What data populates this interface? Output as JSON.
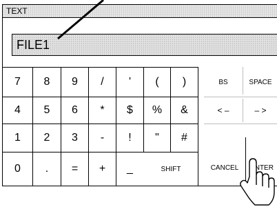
{
  "dialog": {
    "title": "TEXT",
    "input_value": "FILE1"
  },
  "keys": {
    "r1": [
      "7",
      "8",
      "9",
      "/",
      "'",
      "(",
      ")"
    ],
    "r2": [
      "4",
      "5",
      "6",
      "*",
      "$",
      "%",
      "&"
    ],
    "r3": [
      "1",
      "2",
      "3",
      "-",
      "!",
      "\"",
      "#"
    ],
    "r4": [
      "0",
      ".",
      "=",
      "+",
      "_"
    ],
    "shift": "SHIFT",
    "bs": "BS",
    "space": "SPACE",
    "left": "< –",
    "right": "– >",
    "cancel": "CANCEL",
    "enter": "ENTER"
  },
  "icons": {
    "pointer": "pointing-hand-icon",
    "callout": "callout-line"
  }
}
